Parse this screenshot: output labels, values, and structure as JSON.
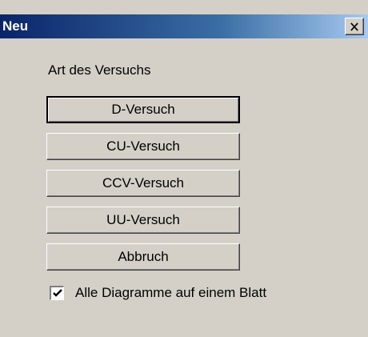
{
  "window": {
    "title": "Neu",
    "close_icon": "close-icon"
  },
  "group": {
    "label": "Art des Versuchs"
  },
  "buttons": [
    {
      "label": "D-Versuch",
      "default": true
    },
    {
      "label": "CU-Versuch"
    },
    {
      "label": "CCV-Versuch"
    },
    {
      "label": "UU-Versuch"
    },
    {
      "label": "Abbruch"
    }
  ],
  "options": {
    "single_sheet_label": "Alle Diagramme auf einem Blatt",
    "single_sheet_checked": true
  },
  "colors": {
    "title_gradient_start": "#0a246a",
    "title_gradient_end": "#a6caf0",
    "face": "#d4d0c8"
  }
}
